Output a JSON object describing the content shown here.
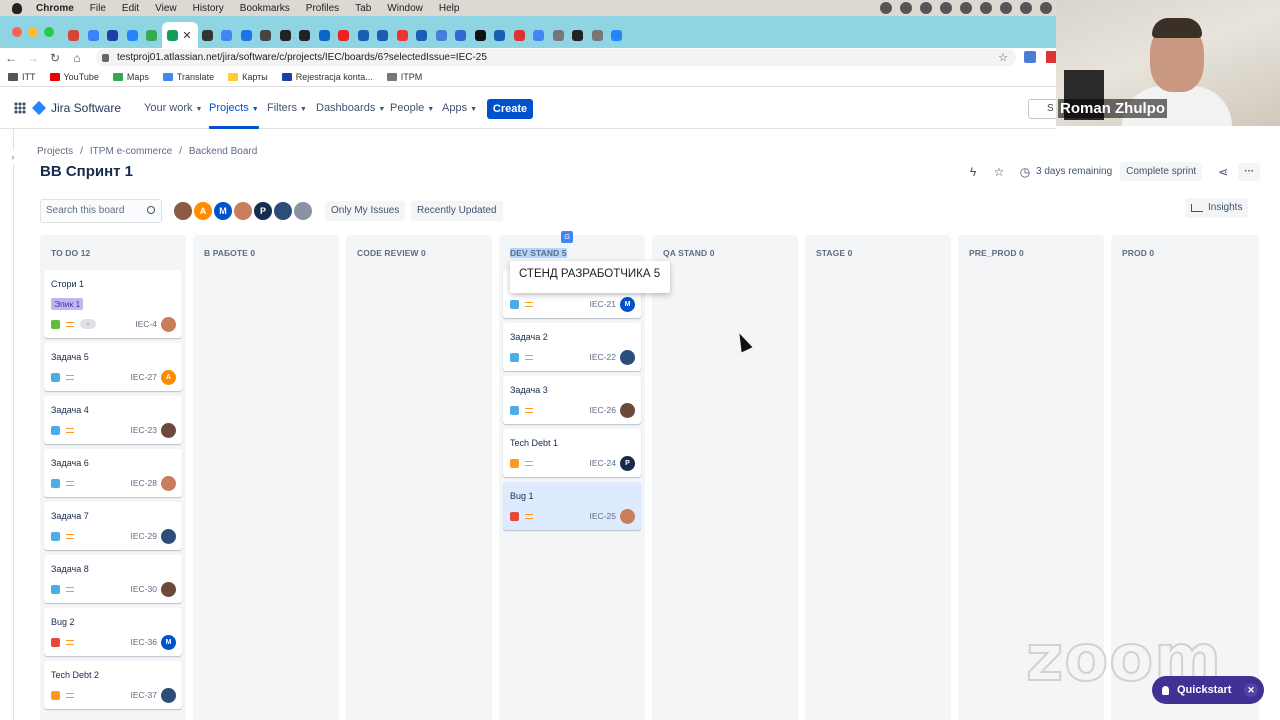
{
  "os": {
    "app": "Chrome",
    "menus": [
      "File",
      "Edit",
      "View",
      "History",
      "Bookmarks",
      "Profiles",
      "Tab",
      "Window",
      "Help"
    ]
  },
  "browser": {
    "url": "testproj01.atlassian.net/jira/software/c/projects/IEC/boards/6?selectedIssue=IEC-25",
    "active_tab_close": "✕",
    "bookmarks": [
      {
        "label": "ITT",
        "color": "#555"
      },
      {
        "label": "YouTube",
        "color": "#e00"
      },
      {
        "label": "Maps",
        "color": "#34a853"
      },
      {
        "label": "Translate",
        "color": "#4285f4"
      },
      {
        "label": "Карты",
        "color": "#fc3"
      },
      {
        "label": "Rejestracja konta...",
        "color": "#1f3fa8"
      },
      {
        "label": "ITPM",
        "color": "#777"
      }
    ]
  },
  "jira": {
    "product": "Jira Software",
    "nav": {
      "your_work": "Your work",
      "projects": "Projects",
      "filters": "Filters",
      "dashboards": "Dashboards",
      "people": "People",
      "apps": "Apps",
      "create": "Create",
      "search": "S"
    },
    "breadcrumbs": [
      "Projects",
      "ITPM e-commerce",
      "Backend Board"
    ],
    "title": "BB Спринт 1",
    "sprint": {
      "remaining": "3 days remaining",
      "complete": "Complete sprint",
      "more": "···"
    },
    "board": {
      "search_placeholder": "Search this board",
      "only_my": "Only My Issues",
      "recently_updated": "Recently Updated",
      "insights": "Insights"
    },
    "avatars": [
      {
        "initial": "",
        "color": "#8a5a44"
      },
      {
        "initial": "A",
        "color": "#ff8b00"
      },
      {
        "initial": "M",
        "color": "#0052cc"
      },
      {
        "initial": "",
        "color": "#c97d5d"
      },
      {
        "initial": "P",
        "color": "#172b4d"
      },
      {
        "initial": "",
        "color": "#2a4d7a"
      },
      {
        "initial": "",
        "color": "#8993a4"
      }
    ],
    "columns": [
      {
        "name": "TO DO 12"
      },
      {
        "name": "В РАБОТЕ 0"
      },
      {
        "name": "CODE REVIEW 0"
      },
      {
        "name": "DEV STAND 5"
      },
      {
        "name": "QA STAND 0"
      },
      {
        "name": "STAGE 0"
      },
      {
        "name": "PRE_PROD 0"
      },
      {
        "name": "PROD 0"
      }
    ],
    "todo_cards": [
      {
        "summary": "Стори 1",
        "epic": "Эпик 1",
        "key": "IEC-4",
        "type": "story",
        "est": "-",
        "avatar": {
          "initial": "",
          "color": "#c97d5d"
        }
      },
      {
        "summary": "Задача 5",
        "key": "IEC-27",
        "type": "task",
        "avatar": {
          "initial": "A",
          "color": "#ff8b00"
        }
      },
      {
        "summary": "Задача 4",
        "key": "IEC-23",
        "type": "task",
        "avatar": {
          "initial": "",
          "color": "#6b4a3a"
        }
      },
      {
        "summary": "Задача 6",
        "key": "IEC-28",
        "type": "task",
        "avatar": {
          "initial": "",
          "color": "#c97d5d"
        }
      },
      {
        "summary": "Задача 7",
        "key": "IEC-29",
        "type": "task",
        "avatar": {
          "initial": "",
          "color": "#2a4d7a"
        }
      },
      {
        "summary": "Задача 8",
        "key": "IEC-30",
        "type": "task",
        "avatar": {
          "initial": "",
          "color": "#6b4a3a"
        }
      },
      {
        "summary": "Bug 2",
        "key": "IEC-36",
        "type": "bug",
        "avatar": {
          "initial": "M",
          "color": "#0052cc"
        }
      },
      {
        "summary": "Tech Debt 2",
        "key": "IEC-37",
        "type": "debt",
        "avatar": {
          "initial": "",
          "color": "#2a4d7a"
        }
      }
    ],
    "dev_cards": [
      {
        "summary": "",
        "key": "IEC-21",
        "type": "task",
        "avatar": {
          "initial": "M",
          "color": "#0052cc"
        }
      },
      {
        "summary": "Задача 2",
        "key": "IEC-22",
        "type": "task",
        "avatar": {
          "initial": "",
          "color": "#2a4d7a"
        }
      },
      {
        "summary": "Задача 3",
        "key": "IEC-26",
        "type": "task",
        "avatar": {
          "initial": "",
          "color": "#6b4a3a"
        }
      },
      {
        "summary": "Tech Debt 1",
        "key": "IEC-24",
        "type": "debt",
        "avatar": {
          "initial": "P",
          "color": "#172b4d"
        }
      },
      {
        "summary": "Bug 1",
        "key": "IEC-25",
        "type": "bug",
        "selected": true,
        "avatar": {
          "initial": "",
          "color": "#c97d5d"
        }
      }
    ],
    "tooltip": "СТЕНД РАЗРАБОТЧИКА 5"
  },
  "meeting": {
    "participant": "Roman Zhulpo",
    "watermark": "zoom"
  },
  "quickstart": {
    "label": "Quickstart",
    "close": "✕"
  },
  "colors": {
    "brand": "#0052cc",
    "task": "#4bade8",
    "story": "#63ba3c",
    "bug": "#e5493a",
    "debt": "#ff991f"
  }
}
